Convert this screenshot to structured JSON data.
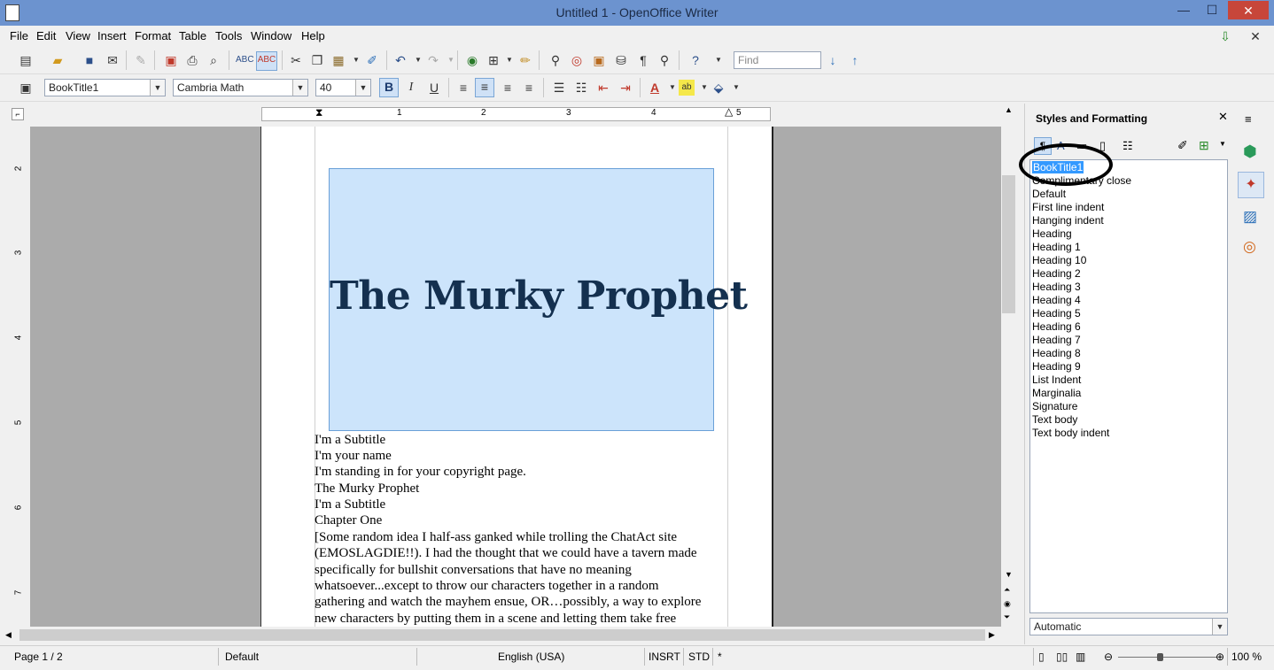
{
  "window": {
    "title": "Untitled 1 - OpenOffice Writer",
    "minimize": "—",
    "maximize": "☐",
    "close": "✕"
  },
  "menu": [
    "File",
    "Edit",
    "View",
    "Insert",
    "Format",
    "Table",
    "Tools",
    "Window",
    "Help"
  ],
  "toolbar": {
    "find_placeholder": "Find"
  },
  "formatting": {
    "paragraph_style": "BookTitle1",
    "font_name": "Cambria Math",
    "font_size": "40",
    "bold": "B",
    "italic": "I",
    "underline": "U"
  },
  "ruler": {
    "marks": [
      "1",
      "2",
      "3",
      "4",
      "5"
    ]
  },
  "vruler": {
    "marks": [
      "2",
      "3",
      "4",
      "5",
      "6",
      "7"
    ]
  },
  "document": {
    "frame_title": "The Murky Prophet",
    "lines": [
      "I'm a Subtitle",
      "I'm your name",
      "I'm standing in for your copyright page.",
      "The Murky Prophet",
      "I'm a Subtitle",
      "Chapter One",
      "[Some random idea I half-ass ganked while trolling the ChatAct site",
      "(EMOSLAGDIE!!). I had the thought that we could have a tavern made",
      "specifically for bullshit conversations that have no meaning",
      "whatsoever...except to throw our characters together in a random",
      "gathering and watch the mayhem ensue, OR…possibly, a way to explore",
      "new characters by putting them in  a scene and letting them take free"
    ]
  },
  "sidebar": {
    "title": "Styles and Formatting",
    "styles": [
      "BookTitle1",
      "Complimentary close",
      "Default",
      "First line indent",
      "Hanging indent",
      "Heading",
      "Heading 1",
      "Heading 10",
      "Heading 2",
      "Heading 3",
      "Heading 4",
      "Heading 5",
      "Heading 6",
      "Heading 7",
      "Heading 8",
      "Heading 9",
      "List Indent",
      "Marginalia",
      "Signature",
      "Text body",
      "Text body indent"
    ],
    "filter": "Automatic"
  },
  "status": {
    "page": "Page 1 / 2",
    "style": "Default",
    "language": "English (USA)",
    "insert": "INSRT",
    "selection": "STD",
    "modified": "*",
    "zoom": "100 %"
  },
  "colors": {
    "titlebar": "#6c93cf",
    "close": "#c7463a",
    "frame": "#cce4fb",
    "title_text": "#14304f",
    "selection": "#3399ff"
  }
}
